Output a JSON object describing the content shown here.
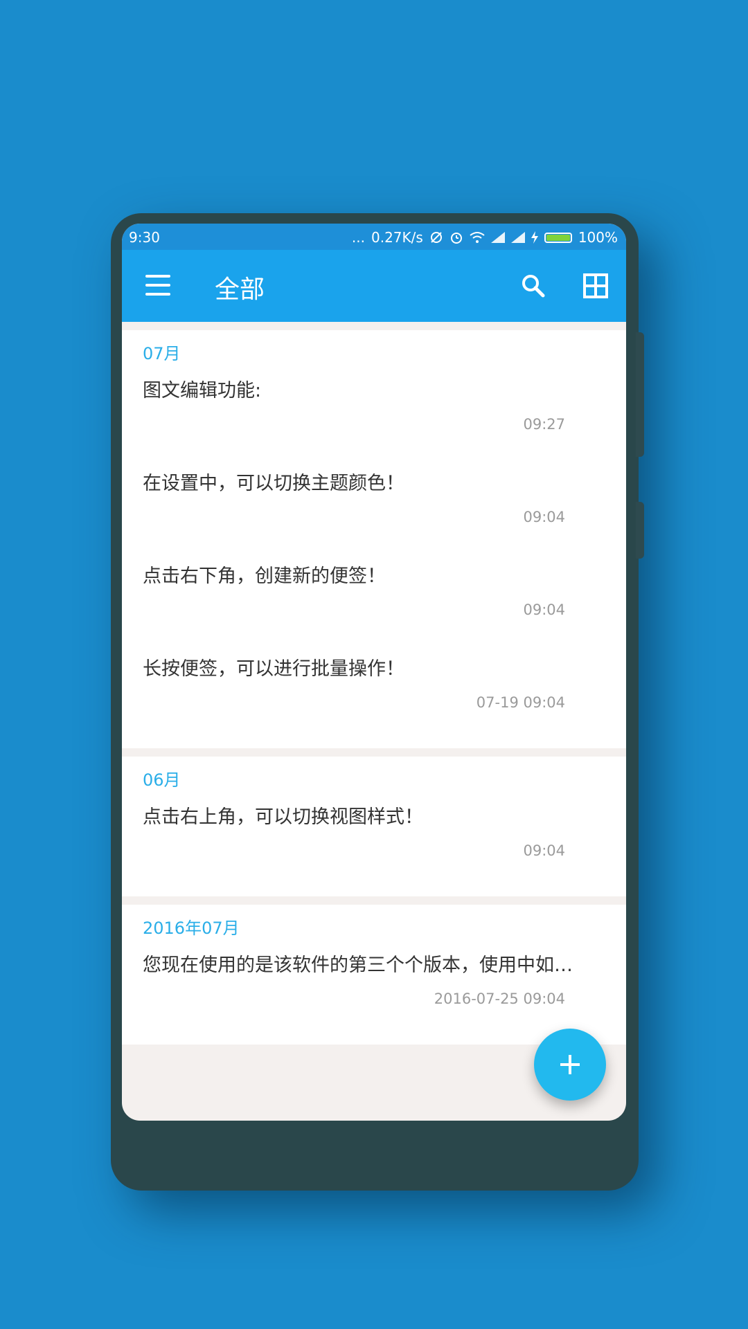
{
  "status_bar": {
    "time": "9:30",
    "dots": "...",
    "net_speed": "0.27K/s",
    "battery_text": "100%",
    "battery_level": 1.0
  },
  "app_bar": {
    "title": "全部",
    "background": "#1aa3ec"
  },
  "sections": [
    {
      "header": "07月",
      "notes": [
        {
          "text": "图文编辑功能:",
          "time": "09:27"
        },
        {
          "text": "在设置中，可以切换主题颜色！",
          "time": "09:04"
        },
        {
          "text": "点击右下角，创建新的便签！",
          "time": "09:04"
        },
        {
          "text": "长按便签，可以进行批量操作！",
          "time": "07-19 09:04"
        }
      ]
    },
    {
      "header": "06月",
      "notes": [
        {
          "text": "点击右上角，可以切换视图样式！",
          "time": "09:04"
        }
      ]
    },
    {
      "header": "2016年07月",
      "notes": [
        {
          "text": "您现在使用的是该软件的第三个个版本，使用中如…",
          "time": "2016-07-25 09:04"
        }
      ]
    }
  ],
  "fab": {
    "label": "+",
    "icon": "add-icon",
    "color": "#22b9ee"
  },
  "colors": {
    "accent": "#2aaee8",
    "background": "#1a8ccc"
  }
}
